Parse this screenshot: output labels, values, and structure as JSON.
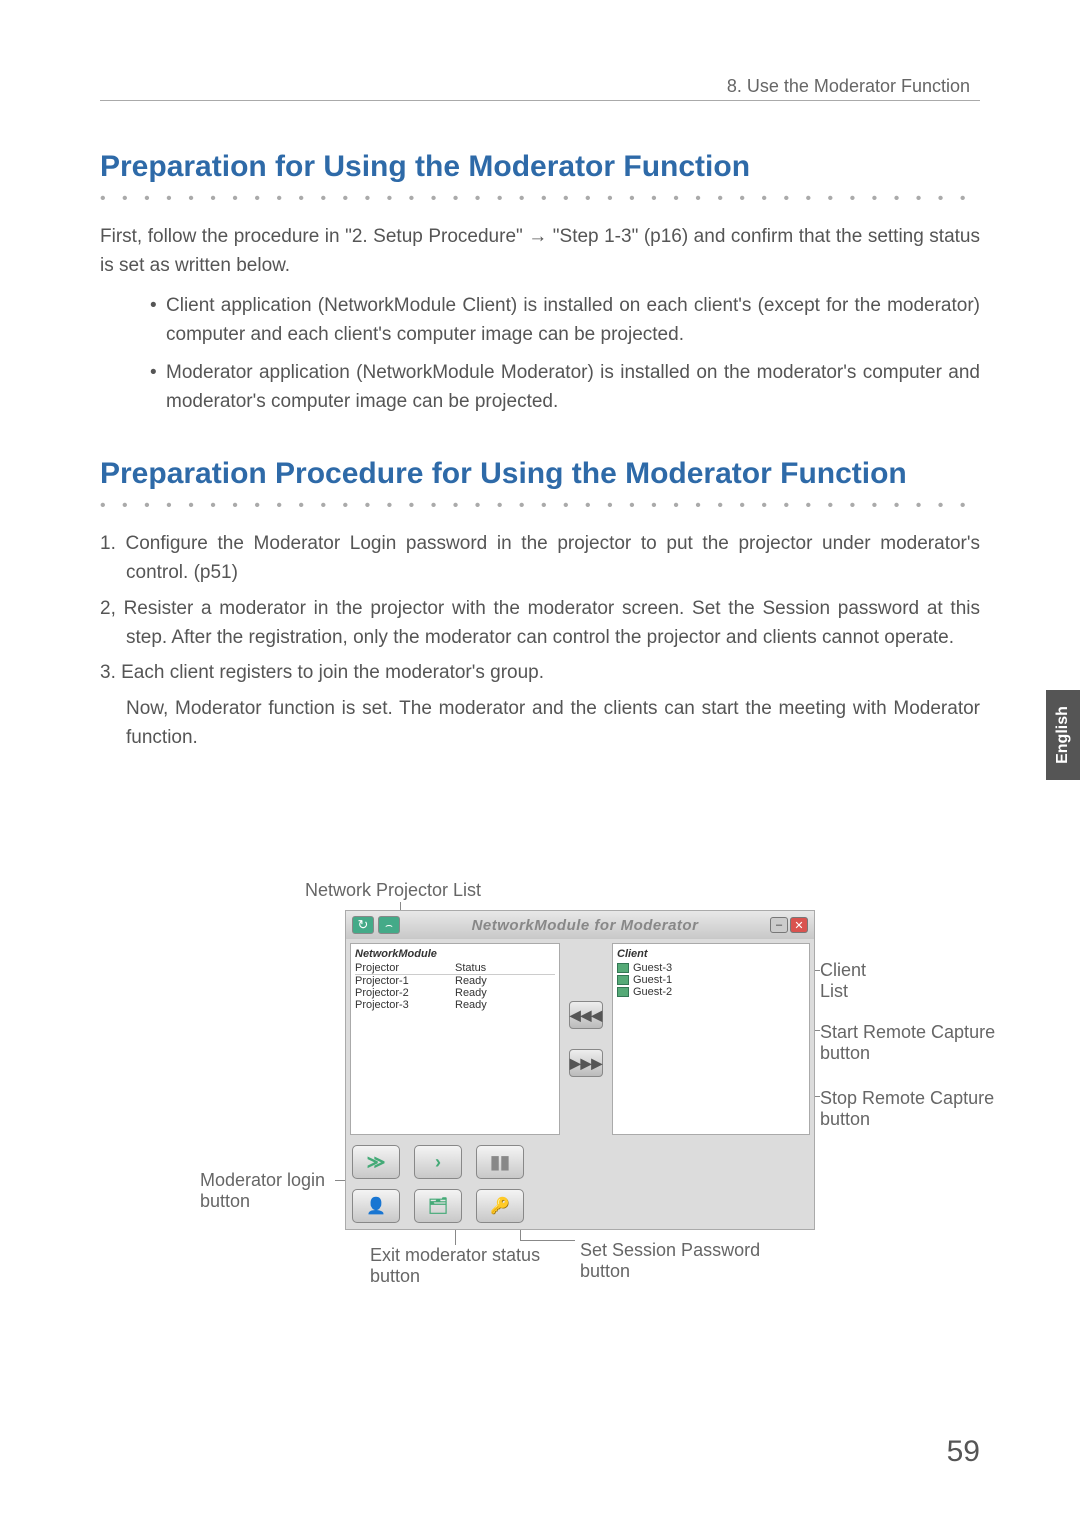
{
  "header": {
    "section": "8. Use the Moderator Function"
  },
  "sideTab": "English",
  "h1a": "Preparation for Using the Moderator Function",
  "intro": "First, follow the procedure in \"2. Setup Procedure\" → \"Step 1-3\" (p16) and confirm that the setting status is set as written below.",
  "bullet1": "Client application (NetworkModule Client) is installed on each client's (except for the moderator) computer and each client's computer image can be projected.",
  "bullet2": "Moderator application (NetworkModule Moderator) is installed on the moderator's computer and moderator's computer image can be projected.",
  "h1b": "Preparation Procedure for Using the Moderator Function",
  "step1": "1. Configure the Moderator Login password in the projector to put the projector under moderator's control.  (p51)",
  "step2": "2, Resister a moderator in the projector with the moderator screen.  Set the Session password at this step.  After the registration, only the moderator can control the projector and clients cannot operate.",
  "step3a": "3. Each client registers to join the moderator's group.",
  "step3b": "Now, Moderator function is set.  The moderator and the clients can start the meeting with Moderator function.",
  "labels": {
    "networkProjectorList": "Network Projector List",
    "clientList": "Client List",
    "startRemote": "Start Remote Capture button",
    "stopRemote": "Stop Remote Capture button",
    "moderatorLogin": "Moderator login button",
    "exitModerator": "Exit moderator status button",
    "setSession": "Set Session Password button"
  },
  "app": {
    "title": "NetworkModule for Moderator",
    "leftPanel": {
      "head": "NetworkModule",
      "colProjector": "Projector",
      "colStatus": "Status",
      "rows": [
        {
          "name": "Projector-1",
          "status": "Ready"
        },
        {
          "name": "Projector-2",
          "status": "Ready"
        },
        {
          "name": "Projector-3",
          "status": "Ready"
        }
      ]
    },
    "rightPanel": {
      "head": "Client",
      "rows": [
        "Guest-3",
        "Guest-1",
        "Guest-2"
      ]
    },
    "midButtons": {
      "back": "◀◀◀",
      "fwd": "▶▶▶"
    },
    "toolbar": {
      "realtime": "≫",
      "onetime": "›",
      "stop": "▮▮",
      "login": "👤",
      "exit": "🗂",
      "session": "🔑"
    }
  },
  "pageNum": "59"
}
